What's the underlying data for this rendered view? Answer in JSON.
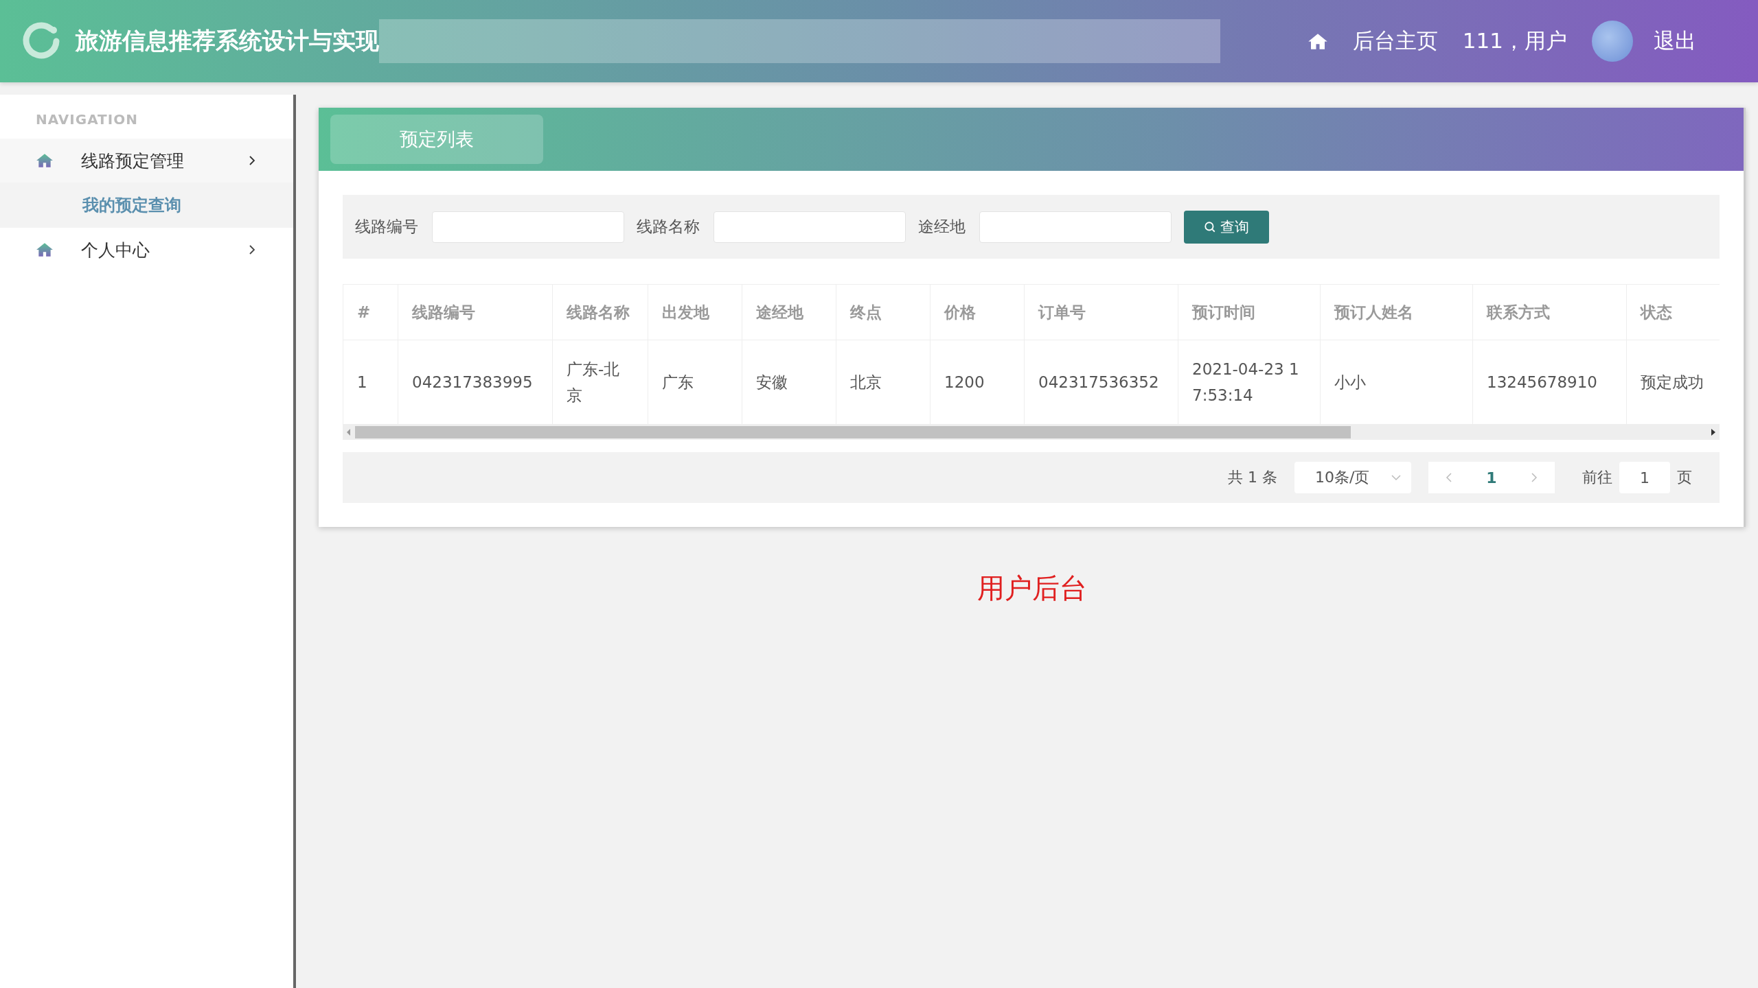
{
  "header": {
    "title": "旅游信息推荐系统设计与实现",
    "home_link": "后台主页",
    "user": "111，用户",
    "logout": "退出"
  },
  "sidebar": {
    "heading": "NAVIGATION",
    "items": [
      {
        "label": "线路预定管理",
        "expanded": true,
        "children": [
          {
            "label": "我的预定查询",
            "selected": true
          }
        ]
      },
      {
        "label": "个人中心",
        "expanded": false
      }
    ]
  },
  "card": {
    "tab": "预定列表"
  },
  "search": {
    "fields": [
      {
        "label": "线路编号"
      },
      {
        "label": "线路名称"
      },
      {
        "label": "途经地"
      }
    ],
    "button": "查询"
  },
  "table": {
    "columns": [
      "#",
      "线路编号",
      "线路名称",
      "出发地",
      "途经地",
      "终点",
      "价格",
      "订单号",
      "预订时间",
      "预订人姓名",
      "联系方式",
      "状态"
    ],
    "rows": [
      [
        "1",
        "042317383995",
        "广东-北京",
        "广东",
        "安徽",
        "北京",
        "1200",
        "042317536352",
        "2021-04-23 17:53:14",
        "小小",
        "13245678910",
        "预定成功"
      ]
    ]
  },
  "pagination": {
    "total": "共 1 条",
    "page_size": "10条/页",
    "pages": [
      {
        "label": "1",
        "selected": true
      }
    ],
    "jump_label": "前往",
    "jump_value": "1",
    "jump_unit": "页"
  },
  "footer_text": "用户后台"
}
